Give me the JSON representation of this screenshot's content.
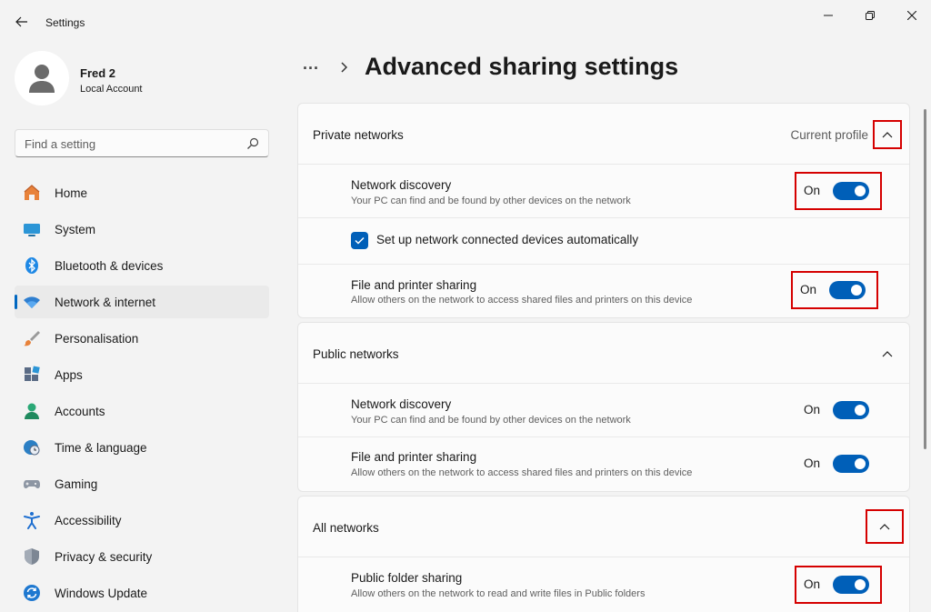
{
  "window": {
    "title": "Settings",
    "controls": {
      "minimize": "minimize-icon",
      "maximize": "restore-icon",
      "close": "close-icon"
    }
  },
  "profile": {
    "name": "Fred 2",
    "account_type": "Local Account"
  },
  "search": {
    "placeholder": "Find a setting",
    "value": ""
  },
  "sidebar": {
    "items": [
      {
        "label": "Home",
        "icon": "home-icon",
        "active": false
      },
      {
        "label": "System",
        "icon": "system-icon",
        "active": false
      },
      {
        "label": "Bluetooth & devices",
        "icon": "bluetooth-icon",
        "active": false
      },
      {
        "label": "Network & internet",
        "icon": "wifi-icon",
        "active": true
      },
      {
        "label": "Personalisation",
        "icon": "brush-icon",
        "active": false
      },
      {
        "label": "Apps",
        "icon": "apps-icon",
        "active": false
      },
      {
        "label": "Accounts",
        "icon": "accounts-icon",
        "active": false
      },
      {
        "label": "Time & language",
        "icon": "clock-globe-icon",
        "active": false
      },
      {
        "label": "Gaming",
        "icon": "gamepad-icon",
        "active": false
      },
      {
        "label": "Accessibility",
        "icon": "accessibility-icon",
        "active": false
      },
      {
        "label": "Privacy & security",
        "icon": "shield-icon",
        "active": false
      },
      {
        "label": "Windows Update",
        "icon": "update-icon",
        "active": false
      }
    ]
  },
  "header": {
    "breadcrumb_more": "...",
    "title": "Advanced sharing settings"
  },
  "sections": {
    "private": {
      "title": "Private networks",
      "meta": "Current profile",
      "network_discovery": {
        "title": "Network discovery",
        "desc": "Your PC can find and be found by other devices on the network",
        "state": "On"
      },
      "auto_setup": {
        "label": "Set up network connected devices automatically",
        "checked": true
      },
      "file_printer_sharing": {
        "title": "File and printer sharing",
        "desc": "Allow others on the network to access shared files and printers on this device",
        "state": "On"
      }
    },
    "public": {
      "title": "Public networks",
      "network_discovery": {
        "title": "Network discovery",
        "desc": "Your PC can find and be found by other devices on the network",
        "state": "On"
      },
      "file_printer_sharing": {
        "title": "File and printer sharing",
        "desc": "Allow others on the network to access shared files and printers on this device",
        "state": "On"
      }
    },
    "all": {
      "title": "All networks",
      "public_folder_sharing": {
        "title": "Public folder sharing",
        "desc": "Allow others on the network to read and write files in Public folders",
        "state": "On"
      }
    }
  },
  "colors": {
    "accent": "#005fb8",
    "highlight": "#d50000",
    "background": "#f3f3f3"
  }
}
